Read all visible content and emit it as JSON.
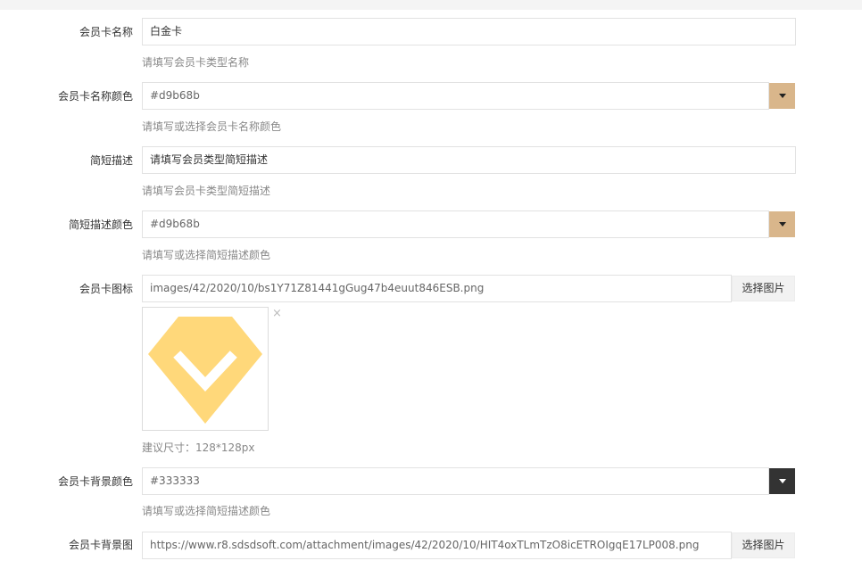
{
  "form": {
    "name": {
      "label": "会员卡名称",
      "value": "白金卡",
      "help": "请填写会员卡类型名称"
    },
    "name_color": {
      "label": "会员卡名称颜色",
      "value": "#d9b68b",
      "swatch": "#d9b68b",
      "help": "请填写或选择会员卡名称颜色"
    },
    "desc": {
      "label": "简短描述",
      "value": "请填写会员类型简短描述",
      "help": "请填写会员卡类型简短描述"
    },
    "desc_color": {
      "label": "简短描述颜色",
      "value": "#d9b68b",
      "swatch": "#d9b68b",
      "help": "请填写或选择简短描述颜色"
    },
    "icon": {
      "label": "会员卡图标",
      "value": "images/42/2020/10/bs1Y71Z81441gGug47b4euut846ESB.png",
      "button": "选择图片",
      "close": "×",
      "help": "建议尺寸：128*128px",
      "icon_color": "#ffd87a"
    },
    "bg_color": {
      "label": "会员卡背景颜色",
      "value": "#333333",
      "swatch": "#333333",
      "help": "请填写或选择简短描述颜色"
    },
    "bg_image": {
      "label": "会员卡背景图",
      "value": "https://www.r8.sdsdsoft.com/attachment/images/42/2020/10/HIT4oxTLmTzO8icETROIgqE17LP008.png",
      "button": "选择图片"
    }
  }
}
